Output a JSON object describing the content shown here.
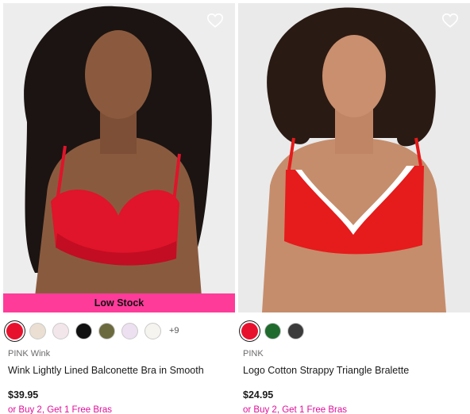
{
  "products": [
    {
      "ribbon": "Low Stock",
      "brand": "PINK Wink",
      "name": "Wink Lightly Lined Balconette Bra in Smooth",
      "price": "$39.95",
      "promo": "or Buy 2, Get 1 Free Bras",
      "more_colors": "+9",
      "swatches": [
        "#e8112d",
        "#eadfd2",
        "#f3e6ea",
        "#111111",
        "#6b6a3e",
        "#ece0f1",
        "#f6f4ef"
      ],
      "selected_swatch": 0,
      "favorite_icon": "heart-outline-icon"
    },
    {
      "brand": "PINK",
      "name": "Logo Cotton Strappy Triangle Bralette",
      "price": "$24.95",
      "promo": "or Buy 2, Get 1 Free Bras",
      "swatches": [
        "#e8112d",
        "#1f6b2e",
        "#3b3b3b"
      ],
      "selected_swatch": 0,
      "favorite_icon": "heart-outline-icon"
    }
  ]
}
